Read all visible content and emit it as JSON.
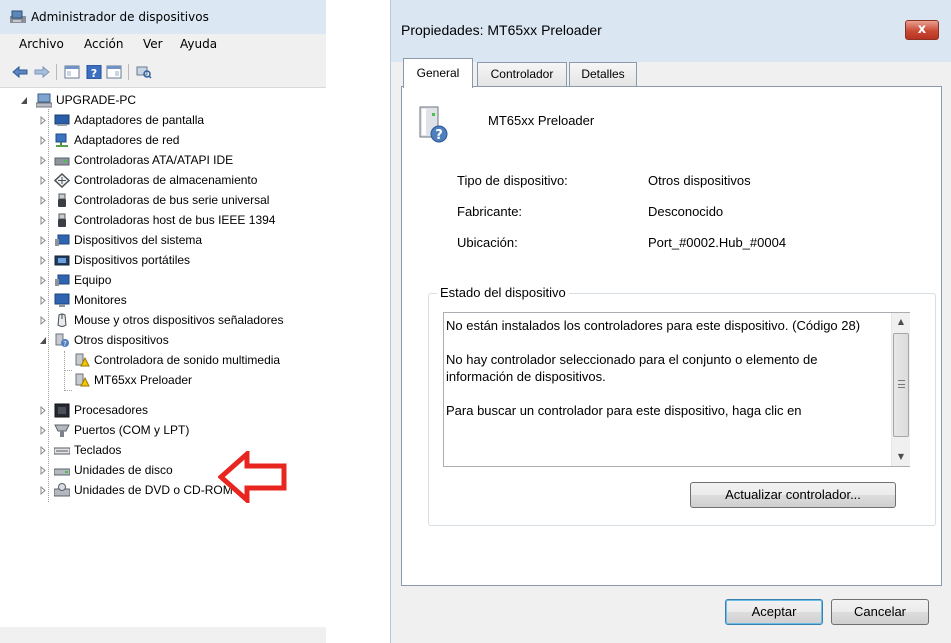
{
  "device_manager": {
    "title": "Administrador de dispositivos",
    "menu": [
      "Archivo",
      "Acción",
      "Ver",
      "Ayuda"
    ],
    "toolbar_icons": [
      "back-arrow-icon",
      "forward-arrow-icon",
      "show-hide-console-icon",
      "help-icon",
      "properties-icon",
      "scan-hardware-icon"
    ],
    "tree": {
      "root": "UPGRADE-PC",
      "items": [
        {
          "label": "Adaptadores de pantalla",
          "icon": "display-adapter-icon",
          "expanded": false
        },
        {
          "label": "Adaptadores de red",
          "icon": "network-adapter-icon",
          "expanded": false
        },
        {
          "label": "Controladoras ATA/ATAPI IDE",
          "icon": "ide-controller-icon",
          "expanded": false
        },
        {
          "label": "Controladoras de almacenamiento",
          "icon": "storage-controller-icon",
          "expanded": false
        },
        {
          "label": "Controladoras de bus serie universal",
          "icon": "usb-icon",
          "expanded": false
        },
        {
          "label": "Controladoras host de bus IEEE 1394",
          "icon": "firewire-icon",
          "expanded": false
        },
        {
          "label": "Dispositivos del sistema",
          "icon": "system-device-icon",
          "expanded": false
        },
        {
          "label": "Dispositivos portátiles",
          "icon": "portable-device-icon",
          "expanded": false
        },
        {
          "label": "Equipo",
          "icon": "computer-icon",
          "expanded": false
        },
        {
          "label": "Monitores",
          "icon": "monitor-icon",
          "expanded": false
        },
        {
          "label": "Mouse y otros dispositivos señaladores",
          "icon": "mouse-icon",
          "expanded": false
        },
        {
          "label": "Otros dispositivos",
          "icon": "unknown-device-icon",
          "expanded": true,
          "children": [
            "Controladora de sonido multimedia",
            "MT65xx Preloader"
          ]
        },
        {
          "label": "Procesadores",
          "icon": "processor-icon",
          "expanded": false
        },
        {
          "label": "Puertos (COM y LPT)",
          "icon": "port-icon",
          "expanded": false
        },
        {
          "label": "Teclados",
          "icon": "keyboard-icon",
          "expanded": false
        },
        {
          "label": "Unidades de disco",
          "icon": "disk-drive-icon",
          "expanded": false
        },
        {
          "label": "Unidades de DVD o CD-ROM",
          "icon": "dvd-drive-icon",
          "expanded": false
        }
      ]
    },
    "annotation_color": "#e8261f"
  },
  "properties": {
    "title": "Propiedades: MT65xx Preloader",
    "close_label": "x",
    "tabs": [
      "General",
      "Controlador",
      "Detalles"
    ],
    "active_tab": "General",
    "device_name": "MT65xx Preloader",
    "fields": [
      {
        "label": "Tipo de dispositivo:",
        "value": "Otros dispositivos"
      },
      {
        "label": "Fabricante:",
        "value": "Desconocido"
      },
      {
        "label": "Ubicación:",
        "value": "Port_#0002.Hub_#0004"
      }
    ],
    "status_title": "Estado del dispositivo",
    "status_paragraphs": [
      "No están instalados los controladores para este dispositivo. (Código 28)",
      "No hay controlador seleccionado para el conjunto o elemento de información de dispositivos.",
      "Para buscar un controlador para este dispositivo, haga clic en"
    ],
    "update_button": "Actualizar controlador...",
    "ok_button": "Aceptar",
    "cancel_button": "Cancelar"
  }
}
